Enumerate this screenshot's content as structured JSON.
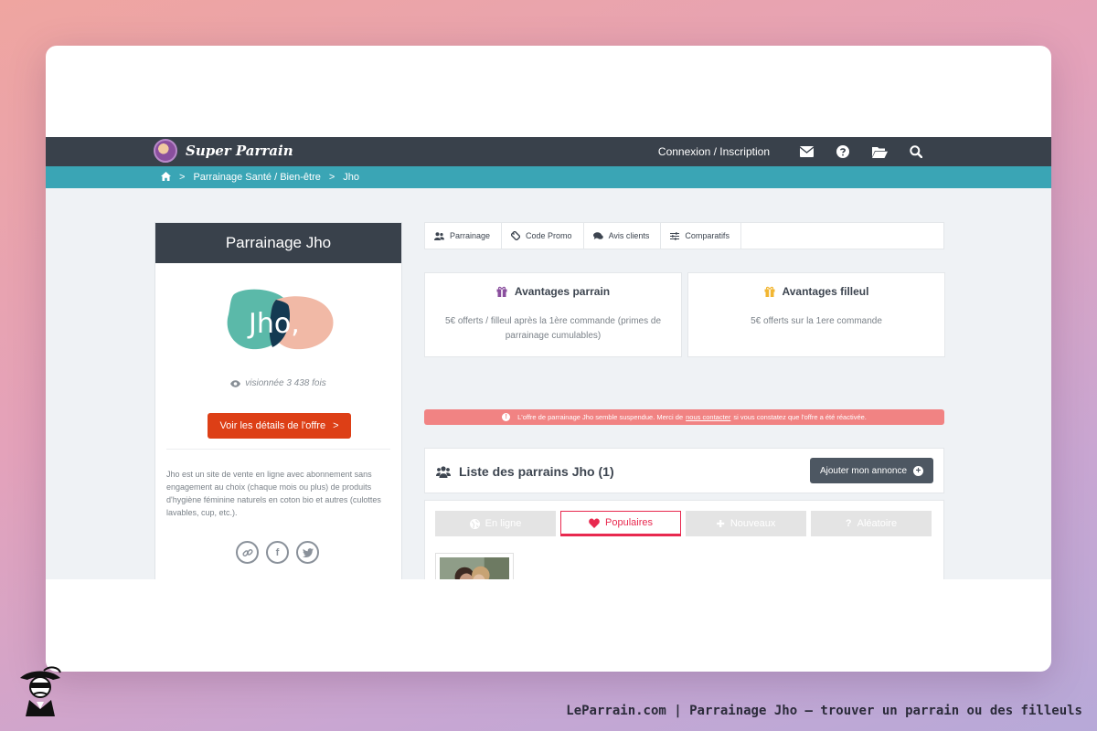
{
  "header": {
    "logo_text": "Super Parrain",
    "login_label": "Connexion / Inscription",
    "icons": [
      "envelope-icon",
      "question-icon",
      "folder-open-icon",
      "search-icon"
    ]
  },
  "breadcrumb": {
    "items": [
      "Parrainage Santé / Bien-être",
      "Jho"
    ],
    "separator": ">"
  },
  "left_panel": {
    "title": "Parrainage Jho",
    "brand_text": "Jho,",
    "views_text": "visionnée 3 438 fois",
    "offer_button": "Voir les détails de l'offre",
    "chevron": ">",
    "description": "Jho est un site de vente en ligne avec abonnement sans engagement au choix (chaque mois ou plus) de produits d'hygiène féminine naturels en coton bio et autres (culottes lavables, cup, etc.).",
    "socials": [
      "link-icon",
      "facebook-icon",
      "twitter-icon"
    ],
    "facebook_glyph": "f",
    "twitter_glyph": "t"
  },
  "tabs": [
    {
      "label": "Parrainage",
      "icon": "users-icon"
    },
    {
      "label": "Code Promo",
      "icon": "ticket-icon"
    },
    {
      "label": "Avis clients",
      "icon": "comments-icon"
    },
    {
      "label": "Comparatifs",
      "icon": "sliders-icon"
    }
  ],
  "advantages": {
    "parrain": {
      "title": "Avantages parrain",
      "text": "5€ offerts / filleul après la 1ère commande (primes de parrainage cumulables)",
      "color": "#8a4f9e"
    },
    "filleul": {
      "title": "Avantages filleul",
      "text": "5€ offerts sur la 1ere commande",
      "color": "#f2b632"
    }
  },
  "alert": {
    "text_before": "L'offre de parrainage Jho semble suspendue. Merci de",
    "link": "nous contacter",
    "text_after": "si vous constatez que l'offre a été réactivée.",
    "icon_glyph": "!"
  },
  "list": {
    "title": "Liste des parrains Jho (1)",
    "add_button": "Ajouter mon annonce",
    "add_glyph": "+",
    "filters": [
      {
        "label": "En ligne",
        "icon": "globe-icon",
        "active": false
      },
      {
        "label": "Populaires",
        "icon": "heart-icon",
        "active": true
      },
      {
        "label": "Nouveaux",
        "icon": "plus-icon",
        "active": false,
        "glyph": "✚"
      },
      {
        "label": "Aléatoire",
        "icon": "question-mark-icon",
        "active": false,
        "glyph": "?"
      }
    ]
  },
  "footer": {
    "caption": "LeParrain.com | Parrainage Jho — trouver un parrain ou des filleuls"
  },
  "colors": {
    "navbar": "#39414b",
    "breadcrumb": "#3aa5b5",
    "offer_button": "#dd3f16",
    "alert": "#f18383",
    "active_filter": "#e8294f"
  }
}
